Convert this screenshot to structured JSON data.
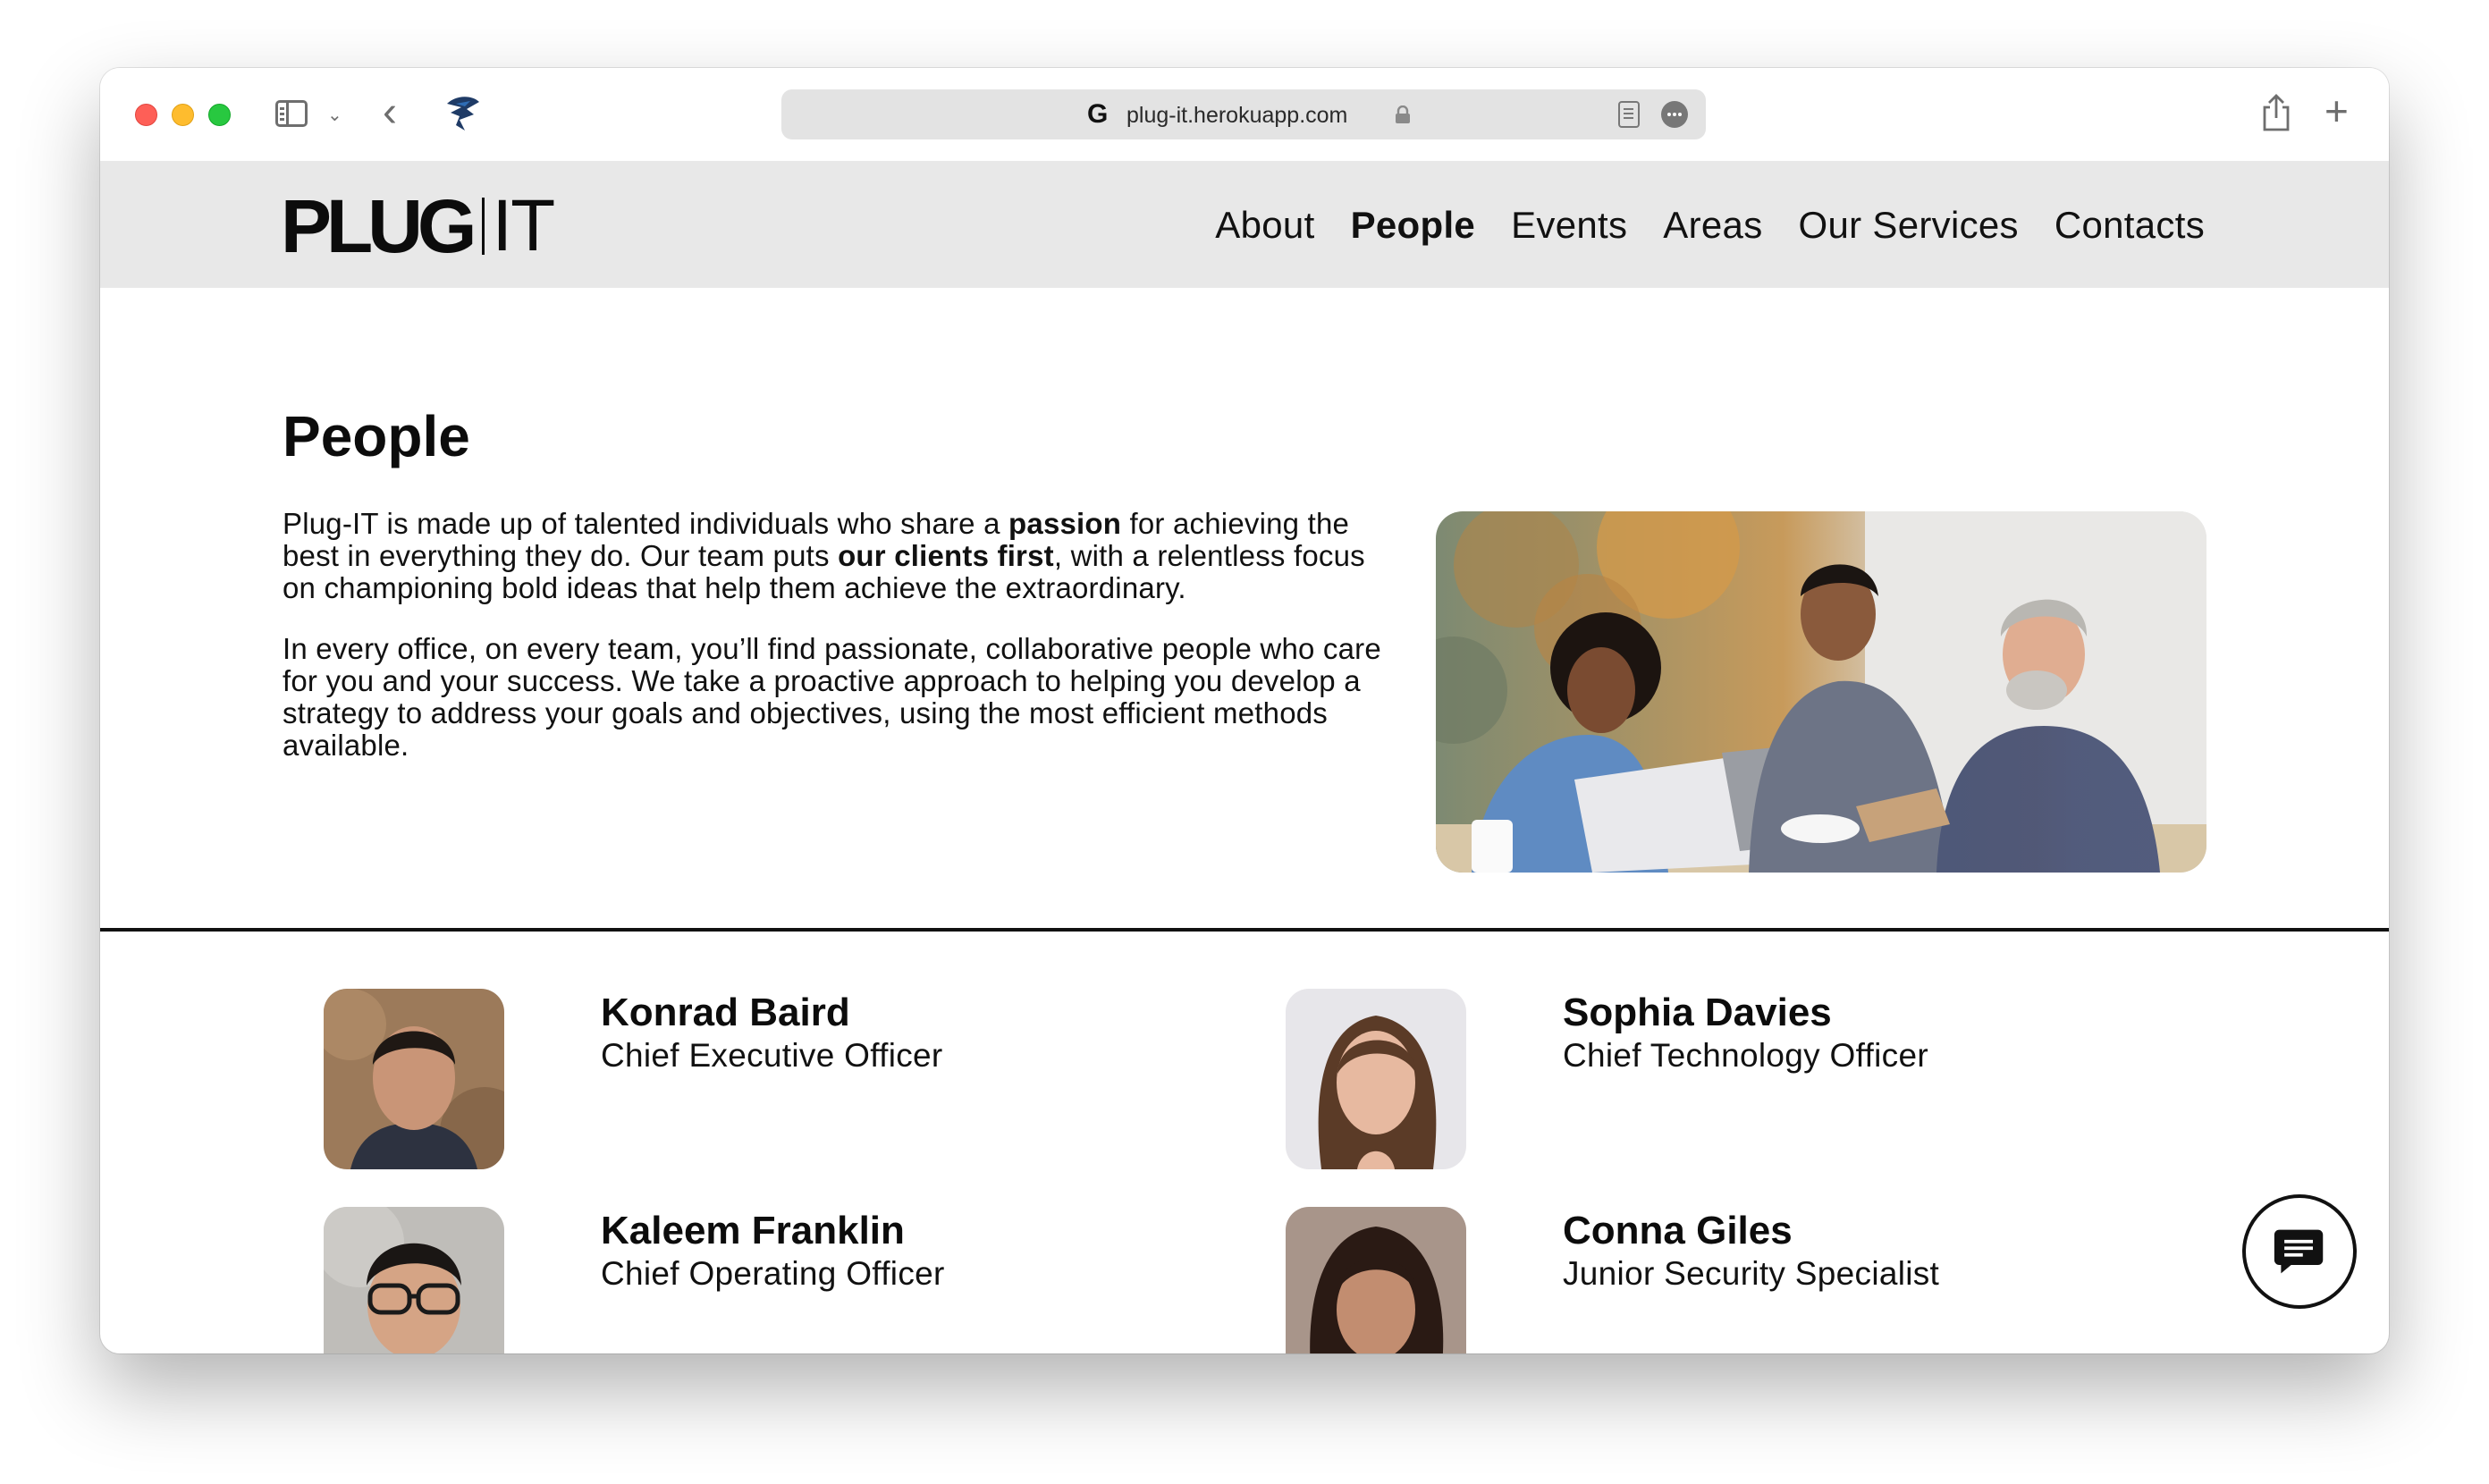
{
  "browser": {
    "url": "plug-it.herokuapp.com"
  },
  "site": {
    "logo_main": "PLUG",
    "logo_suffix": "IT",
    "nav": [
      {
        "label": "About",
        "active": false
      },
      {
        "label": "People",
        "active": true
      },
      {
        "label": "Events",
        "active": false
      },
      {
        "label": "Areas",
        "active": false
      },
      {
        "label": "Our Services",
        "active": false
      },
      {
        "label": "Contacts",
        "active": false
      }
    ]
  },
  "page": {
    "title": "People",
    "intro_p1_a": "Plug-IT is made up of talented individuals who share a ",
    "intro_p1_b": "passion",
    "intro_p1_c": " for achieving the best in everything they do. Our team puts ",
    "intro_p1_d": "our clients first",
    "intro_p1_e": ", with a relentless focus on championing bold ideas that help them achieve the extraordinary.",
    "intro_p2": "In every office, on every team, you’ll find passionate, collaborative people who care for you and your success. We take a proactive approach to helping you develop a strategy to address your goals and objectives, using the most efficient methods available."
  },
  "people": [
    {
      "name": "Konrad Baird",
      "role": "Chief Executive Officer"
    },
    {
      "name": "Sophia Davies",
      "role": "Chief Technology Officer"
    },
    {
      "name": "Kaleem Franklin",
      "role": "Chief Operating Officer"
    },
    {
      "name": "Conna Giles",
      "role": "Junior Security Specialist"
    }
  ],
  "icons": {
    "chat": "chat-icon",
    "share": "share-icon",
    "new_tab": "plus-icon"
  },
  "colors": {
    "header_bg": "#e8e8e8",
    "text": "#111111",
    "accent": "#0c0c0c"
  }
}
